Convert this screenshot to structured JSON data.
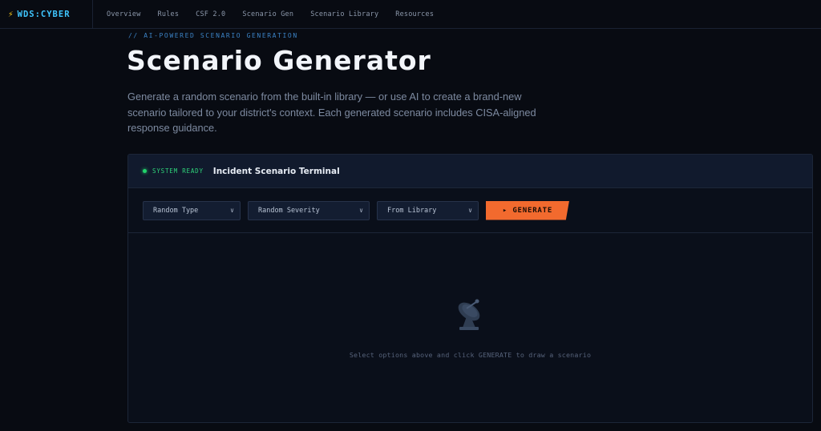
{
  "nav": {
    "brand": "WDS:CYBER",
    "brand_icon": "lightning-bolt-icon",
    "links": [
      "Overview",
      "Rules",
      "CSF 2.0",
      "Scenario Gen",
      "Scenario Library",
      "Resources"
    ]
  },
  "header": {
    "eyebrow": "// AI-POWERED SCENARIO GENERATION",
    "title": "Scenario Generator",
    "description": "Generate a random scenario from the built-in library — or use AI to create a brand-new scenario tailored to your district's context. Each generated scenario includes CISA-aligned response guidance."
  },
  "terminal": {
    "status": "SYSTEM READY",
    "title": "Incident Scenario Terminal",
    "selects": {
      "type": "Random Type",
      "severity": "Random Severity",
      "source": "From Library"
    },
    "generate_label": "▸ GENERATE",
    "empty_icon": "satellite-dish-icon",
    "empty_text": "Select options above and click GENERATE to draw a scenario"
  },
  "colors": {
    "background": "#080b12",
    "accent": "#f26a2e",
    "brand": "#3fc6ff",
    "status": "#22d36b"
  }
}
